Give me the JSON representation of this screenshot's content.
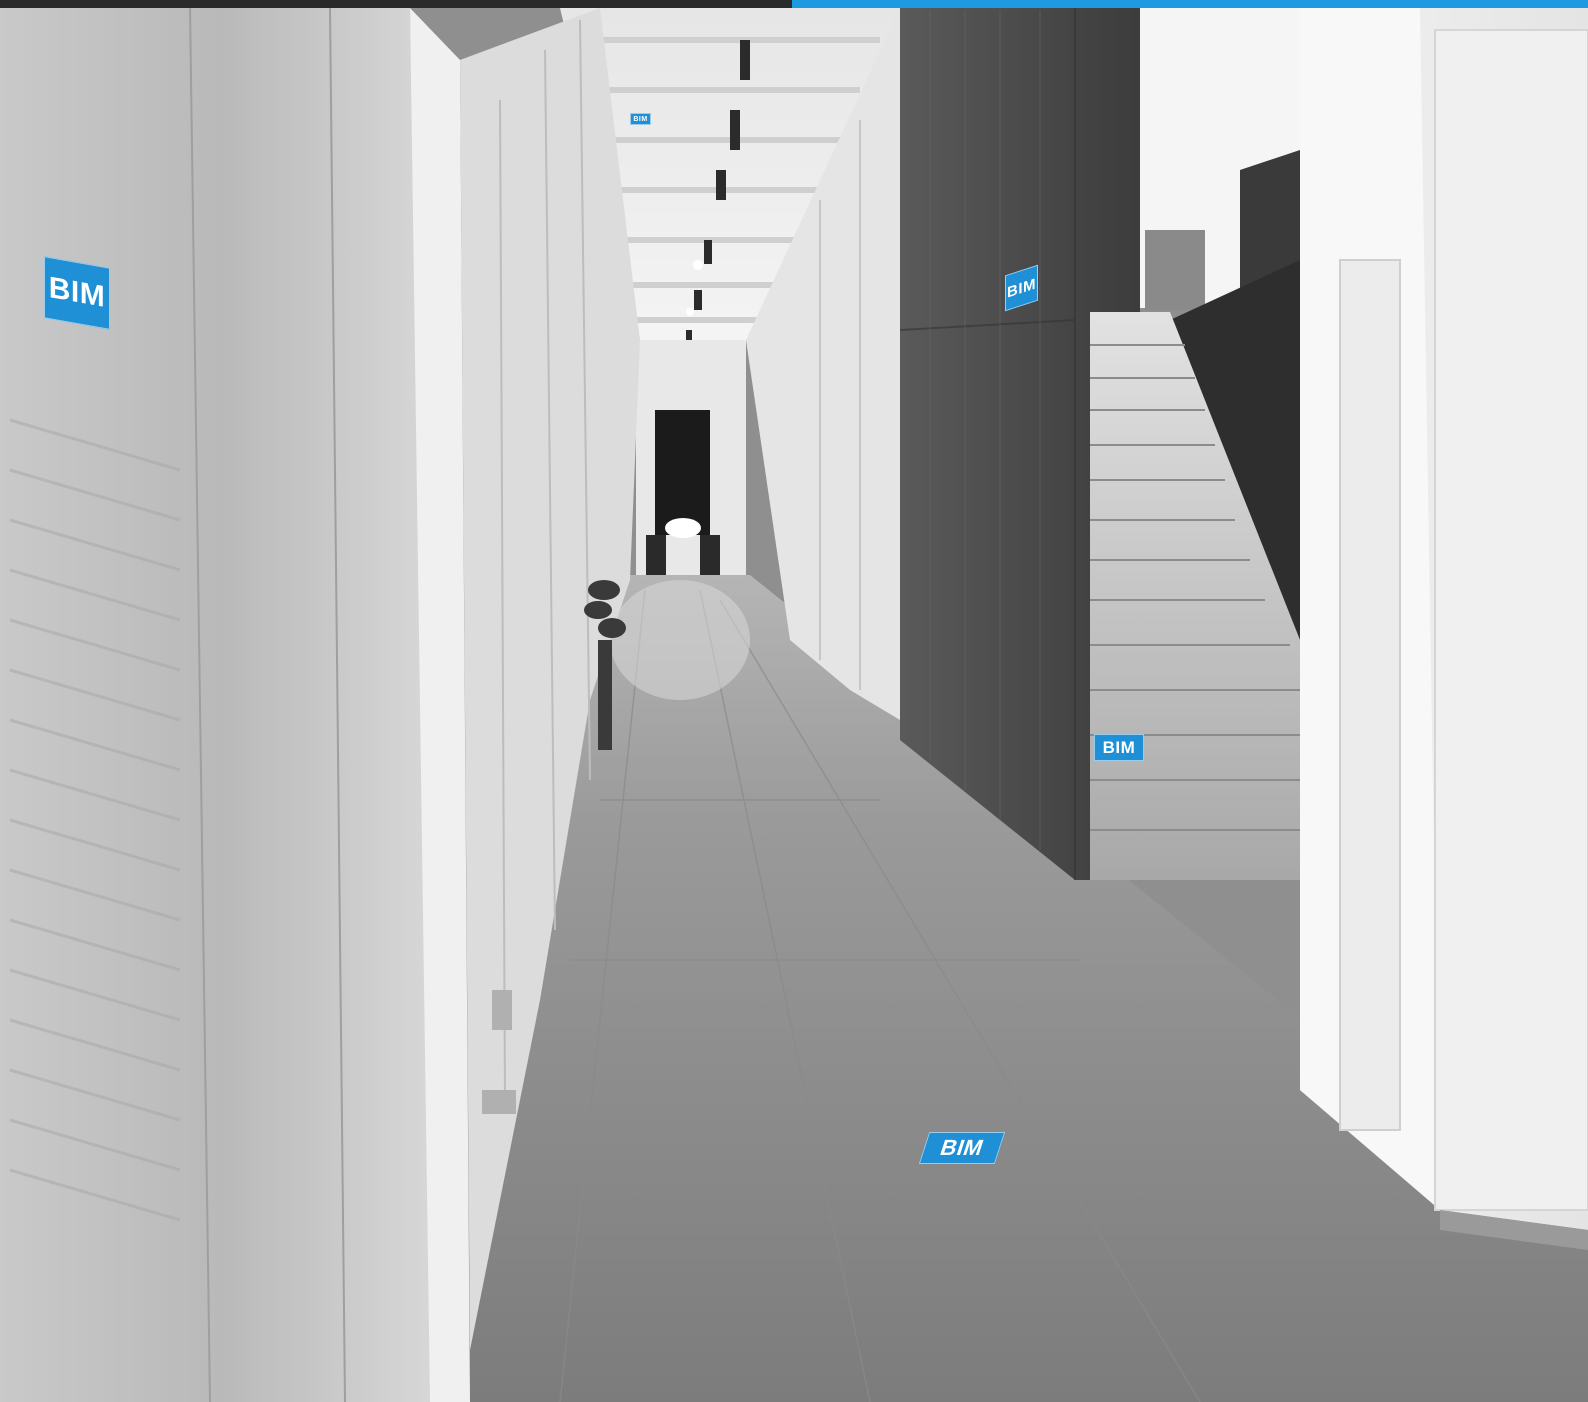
{
  "scene": {
    "description_colors": {
      "accent": "#1f8fd6",
      "top_bar_dark": "#2a2a2a",
      "top_bar_blue": "#1e9be0"
    }
  },
  "tags": {
    "left_wall": "BIM",
    "ceiling": "BIM",
    "wood_wall": "BIM",
    "stairs": "BIM",
    "floor": "BIM"
  }
}
